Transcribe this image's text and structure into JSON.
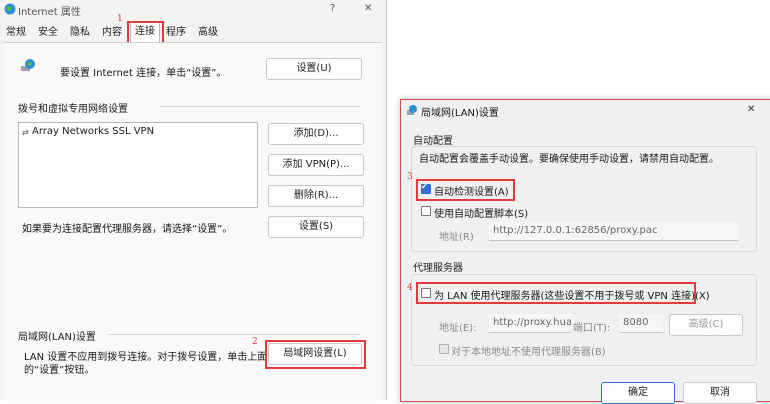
{
  "main": {
    "title": "Internet 属性",
    "help": "?",
    "close": "✕",
    "tabs": [
      "常规",
      "安全",
      "隐私",
      "内容",
      "连接",
      "程序",
      "高级"
    ],
    "setup_text": "要设置 Internet 连接，单击“设置”。",
    "setup_button": "设置(U)",
    "dialup_section": "拨号和虚拟专用网络设置",
    "vpn_item": "Array Networks SSL VPN",
    "add_button": "添加(D)...",
    "add_vpn_button": "添加 VPN(P)...",
    "remove_button": "删除(R)...",
    "settings_button": "设置(S)",
    "proxy_hint": "如果要为连接配置代理服务器，请选择“设置”。",
    "lan_section": "局域网(LAN)设置",
    "lan_note_1": "LAN 设置不应用到拨号连接。对于拨号设置，单击上面",
    "lan_note_2": "的“设置”按钮。",
    "lan_button": "局域网设置(L)"
  },
  "annotations": {
    "n1": "1",
    "n2": "2",
    "n3": "3",
    "n4": "4"
  },
  "lan": {
    "title": "局域网(LAN)设置",
    "close": "✕",
    "auto_group": "自动配置",
    "auto_desc": "自动配置会覆盖手动设置。要确保使用手动设置，请禁用自动配置。",
    "auto_detect": "自动检测设置(A)",
    "auto_detect_checked": true,
    "use_script": "使用自动配置脚本(S)",
    "use_script_checked": false,
    "address_label": "地址(R)",
    "address_value": "http://127.0.0.1:62856/proxy.pac",
    "proxy_group": "代理服务器",
    "use_proxy": "为 LAN 使用代理服务器(这些设置不用于拨号或 VPN 连接)(X)",
    "use_proxy_checked": false,
    "addr_label": "地址(E):",
    "addr_value": "http://proxy.huav",
    "port_label": "端口(T):",
    "port_value": "8080",
    "advanced_button": "高级(C)",
    "bypass_local": "对于本地地址不使用代理服务器(B)",
    "ok_button": "确定",
    "cancel_button": "取消"
  },
  "colors": {
    "annotation_red": "#e23b3b",
    "accent": "#2f6fd6"
  }
}
